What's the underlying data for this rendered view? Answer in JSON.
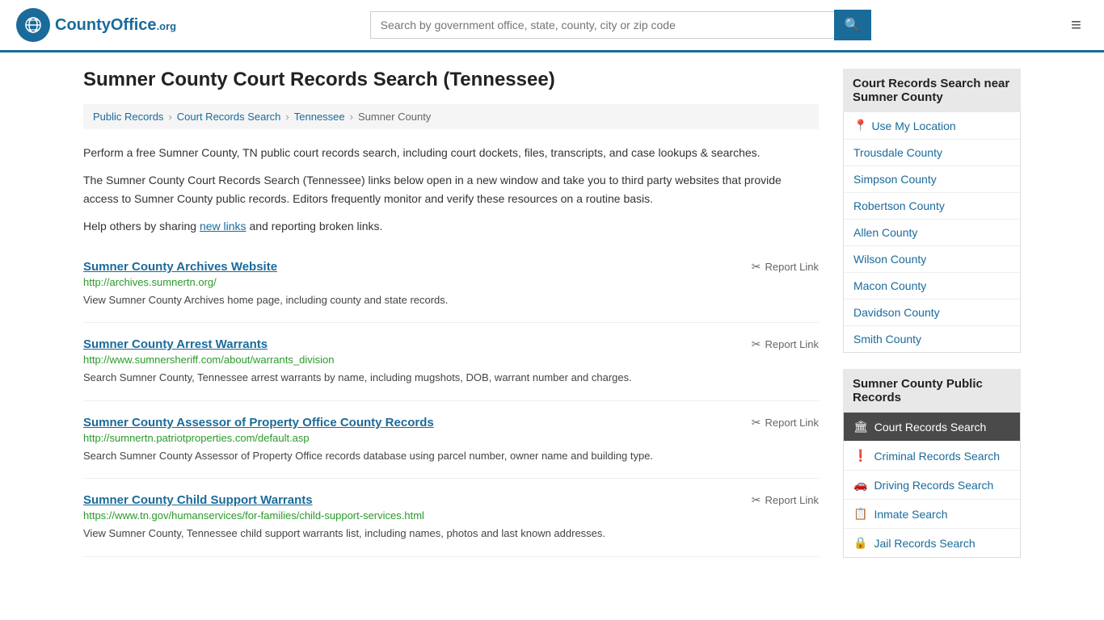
{
  "header": {
    "logo_text": "CountyOffice",
    "logo_org": ".org",
    "search_placeholder": "Search by government office, state, county, city or zip code"
  },
  "page": {
    "title": "Sumner County Court Records Search (Tennessee)"
  },
  "breadcrumb": {
    "items": [
      {
        "label": "Public Records",
        "href": "#"
      },
      {
        "label": "Court Records Search",
        "href": "#"
      },
      {
        "label": "Tennessee",
        "href": "#"
      },
      {
        "label": "Sumner County",
        "href": "#"
      }
    ]
  },
  "description": {
    "para1": "Perform a free Sumner County, TN public court records search, including court dockets, files, transcripts, and case lookups & searches.",
    "para2": "The Sumner County Court Records Search (Tennessee) links below open in a new window and take you to third party websites that provide access to Sumner County public records. Editors frequently monitor and verify these resources on a routine basis.",
    "para3_prefix": "Help others by sharing ",
    "new_links": "new links",
    "para3_suffix": " and reporting broken links."
  },
  "results": [
    {
      "title": "Sumner County Archives Website",
      "url": "http://archives.sumnertn.org/",
      "desc": "View Sumner County Archives home page, including county and state records.",
      "report_label": "Report Link"
    },
    {
      "title": "Sumner County Arrest Warrants",
      "url": "http://www.sumnersheriff.com/about/warrants_division",
      "desc": "Search Sumner County, Tennessee arrest warrants by name, including mugshots, DOB, warrant number and charges.",
      "report_label": "Report Link"
    },
    {
      "title": "Sumner County Assessor of Property Office County Records",
      "url": "http://sumnertn.patriotproperties.com/default.asp",
      "desc": "Search Sumner County Assessor of Property Office records database using parcel number, owner name and building type.",
      "report_label": "Report Link"
    },
    {
      "title": "Sumner County Child Support Warrants",
      "url": "https://www.tn.gov/humanservices/for-families/child-support-services.html",
      "desc": "View Sumner County, Tennessee child support warrants list, including names, photos and last known addresses.",
      "report_label": "Report Link"
    }
  ],
  "sidebar": {
    "nearby_title": "Court Records Search near Sumner County",
    "nearby_links": [
      {
        "label": "Use My Location"
      },
      {
        "label": "Trousdale County"
      },
      {
        "label": "Simpson County"
      },
      {
        "label": "Robertson County"
      },
      {
        "label": "Allen County"
      },
      {
        "label": "Wilson County"
      },
      {
        "label": "Macon County"
      },
      {
        "label": "Davidson County"
      },
      {
        "label": "Smith County"
      }
    ],
    "public_records_title": "Sumner County Public Records",
    "public_records_nav": [
      {
        "label": "Court Records Search",
        "icon": "🏛",
        "active": true
      },
      {
        "label": "Criminal Records Search",
        "icon": "❗"
      },
      {
        "label": "Driving Records Search",
        "icon": "🚗"
      },
      {
        "label": "Inmate Search",
        "icon": "📋"
      },
      {
        "label": "Jail Records Search",
        "icon": "🔒"
      }
    ]
  }
}
